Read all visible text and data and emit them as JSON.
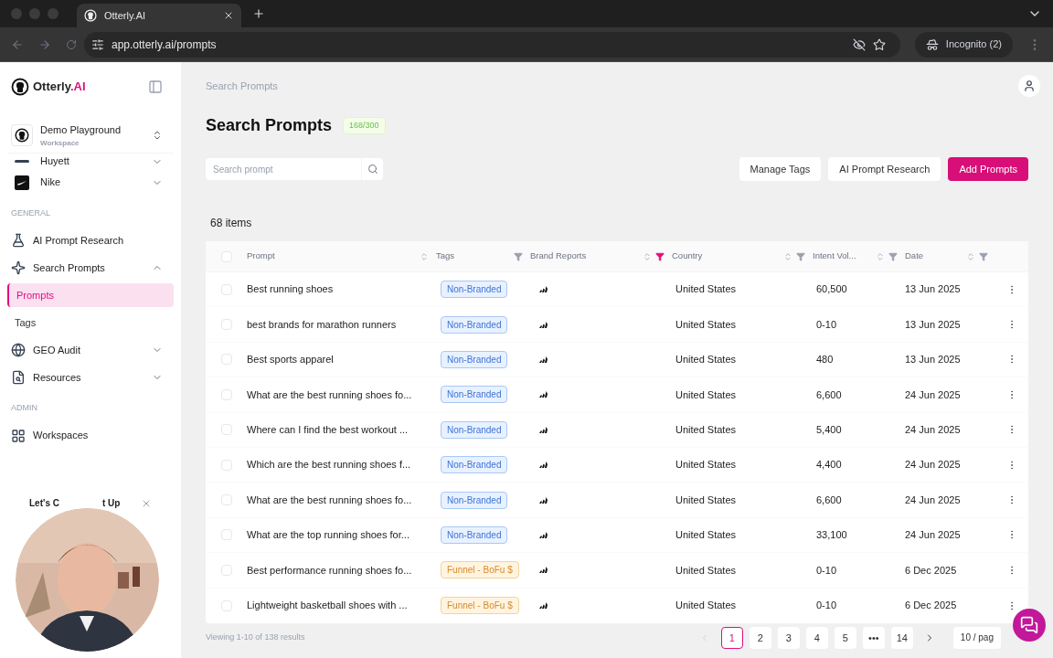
{
  "browser": {
    "tab_title": "Otterly.AI",
    "url": "app.otterly.ai/prompts",
    "incognito": "Incognito (2)"
  },
  "sidebar": {
    "logo": {
      "name": "Otterly",
      "suffix": ".AI"
    },
    "workspace": {
      "name": "Demo Playground",
      "subtitle": "Workspace"
    },
    "brands": [
      {
        "label": "Huyett",
        "kind": "dash"
      },
      {
        "label": "Nike",
        "kind": "swoosh"
      }
    ],
    "sections": [
      {
        "title": "GENERAL",
        "items": [
          {
            "label": "AI Prompt Research",
            "selected": false
          },
          {
            "label": "Search Prompts",
            "expanded": true,
            "selected": false,
            "children": [
              {
                "label": "Prompts",
                "selected": true
              },
              {
                "label": "Tags",
                "selected": false
              }
            ]
          },
          {
            "label": "GEO Audit",
            "expanded": false,
            "selected": false
          },
          {
            "label": "Resources",
            "expanded": false,
            "selected": false
          }
        ]
      },
      {
        "title": "ADMIN",
        "items": [
          {
            "label": "Workspaces",
            "selected": false
          }
        ]
      }
    ],
    "promo": {
      "title_left": "Let's C",
      "title_right": "t Up"
    }
  },
  "breadcrumb": "Search Prompts",
  "page": {
    "title": "Search Prompts",
    "quota": "168/300"
  },
  "search": {
    "placeholder": "Search prompt"
  },
  "buttons": [
    {
      "label": "Manage Tags",
      "kind": "secondary"
    },
    {
      "label": "AI Prompt Research",
      "kind": "secondary"
    },
    {
      "label": "Add Prompts",
      "kind": "primary"
    }
  ],
  "item_count": "68 items",
  "table": {
    "select_all_checked": false,
    "columns": [
      {
        "label": "Prompt",
        "sort": true,
        "filter": false
      },
      {
        "label": "Tags",
        "sort": false,
        "filter": true,
        "filter_active": false
      },
      {
        "label": "Brand Reports",
        "sort": true,
        "filter": true,
        "filter_active": true
      },
      {
        "label": "Country",
        "sort": true,
        "filter": true,
        "filter_active": false
      },
      {
        "label": "Intent Vol...",
        "sort": true,
        "filter": true,
        "filter_active": false
      },
      {
        "label": "Date",
        "sort": true,
        "filter": true,
        "filter_active": false
      }
    ],
    "rows": [
      {
        "checked": false,
        "prompt": "Best running shoes",
        "tag": {
          "label": "Non-Branded",
          "kind": "blue"
        },
        "country": "United States",
        "volume": "60,500",
        "date": "13 Jun 2025"
      },
      {
        "checked": false,
        "prompt": "best brands for marathon runners",
        "tag": {
          "label": "Non-Branded",
          "kind": "blue"
        },
        "country": "United States",
        "volume": "0-10",
        "date": "13 Jun 2025"
      },
      {
        "checked": false,
        "prompt": "Best sports apparel",
        "tag": {
          "label": "Non-Branded",
          "kind": "blue"
        },
        "country": "United States",
        "volume": "480",
        "date": "13 Jun 2025"
      },
      {
        "checked": false,
        "prompt": "What are the best running shoes fo...",
        "tag": {
          "label": "Non-Branded",
          "kind": "blue"
        },
        "country": "United States",
        "volume": "6,600",
        "date": "24 Jun 2025"
      },
      {
        "checked": false,
        "prompt": "Where can I find the best workout ...",
        "tag": {
          "label": "Non-Branded",
          "kind": "blue"
        },
        "country": "United States",
        "volume": "5,400",
        "date": "24 Jun 2025"
      },
      {
        "checked": false,
        "prompt": "Which are the best running shoes f...",
        "tag": {
          "label": "Non-Branded",
          "kind": "blue"
        },
        "country": "United States",
        "volume": "4,400",
        "date": "24 Jun 2025"
      },
      {
        "checked": false,
        "prompt": "What are the best running shoes fo...",
        "tag": {
          "label": "Non-Branded",
          "kind": "blue"
        },
        "country": "United States",
        "volume": "6,600",
        "date": "24 Jun 2025"
      },
      {
        "checked": false,
        "prompt": "What are the top running shoes for...",
        "tag": {
          "label": "Non-Branded",
          "kind": "blue"
        },
        "country": "United States",
        "volume": "33,100",
        "date": "24 Jun 2025"
      },
      {
        "checked": false,
        "prompt": "Best performance running shoes fo...",
        "tag": {
          "label": "Funnel - BoFu $",
          "kind": "orange"
        },
        "country": "United States",
        "volume": "0-10",
        "date": "6 Dec 2025"
      },
      {
        "checked": false,
        "prompt": "Lightweight basketball shoes with ...",
        "tag": {
          "label": "Funnel - BoFu $",
          "kind": "orange"
        },
        "country": "United States",
        "volume": "0-10",
        "date": "6 Dec 2025"
      }
    ]
  },
  "pagination": {
    "summary": "Viewing 1-10 of 138 results",
    "pages": [
      {
        "label": "1",
        "selected": true
      },
      {
        "label": "2",
        "selected": false
      },
      {
        "label": "3",
        "selected": false
      },
      {
        "label": "4",
        "selected": false
      },
      {
        "label": "5",
        "selected": false
      },
      {
        "label": "•••",
        "selected": false
      },
      {
        "label": "14",
        "selected": false
      }
    ],
    "page_size": "10 / pag"
  }
}
